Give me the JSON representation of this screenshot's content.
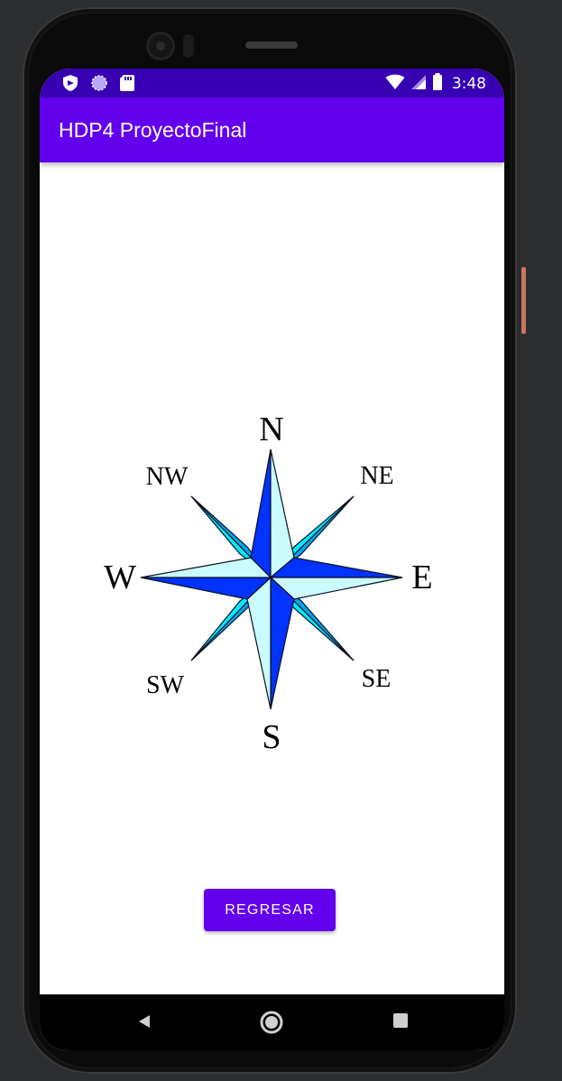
{
  "status_bar": {
    "time": "3:48",
    "left_icons": [
      "shield-icon",
      "circle-icon",
      "sd-card-icon"
    ],
    "right_icons": [
      "wifi-icon",
      "signal-icon",
      "battery-icon"
    ]
  },
  "app_bar": {
    "title": "HDP4 ProyectoFinal"
  },
  "compass": {
    "labels": {
      "n": "N",
      "ne": "NE",
      "e": "E",
      "se": "SE",
      "s": "S",
      "sw": "SW",
      "w": "W",
      "nw": "NW"
    },
    "colors": {
      "dark_blue": "#0033ff",
      "light_cyan": "#c9fbff",
      "cyan": "#00eaff",
      "mid_blue": "#00a8f0"
    }
  },
  "actions": {
    "back_button_label": "REGRESAR"
  },
  "nav_bar": {
    "icons": [
      "back-icon",
      "home-icon",
      "recents-icon"
    ]
  },
  "colors": {
    "primary": "#6200ee",
    "primary_dark": "#3700b3"
  }
}
